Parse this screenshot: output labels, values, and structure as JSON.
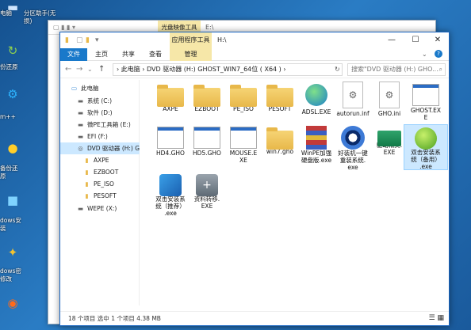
{
  "desktop": {
    "icons": [
      {
        "label": "电脑",
        "icon": "computer-icon"
      },
      {
        "label": "份还原",
        "icon": "backup-icon"
      },
      {
        "label": "m++",
        "icon": "gear-icon"
      },
      {
        "label": "备份还\n原",
        "icon": "ghost-icon"
      },
      {
        "label": "dows安\n装",
        "icon": "windows-installer-icon"
      },
      {
        "label": "dows密\n修改",
        "icon": "key-icon"
      },
      {
        "label": "",
        "icon": "app-icon"
      }
    ],
    "top_label": "分区助手(无\n损)"
  },
  "backwin": {
    "tab": "光盘映像工具",
    "path": "E:\\"
  },
  "window": {
    "context_tab": "应用程序工具",
    "title": "H:\\",
    "ribbon_tabs": [
      "文件",
      "主页",
      "共享",
      "查看",
      "管理"
    ],
    "address": "›  此电脑  ›  DVD 驱动器 (H:) GHOST_WIN7_64位 ( X64 )  ›",
    "search_placeholder": "搜索\"DVD 驱动器 (H:) GHO...",
    "nav": [
      {
        "label": "此电脑",
        "icon": "computer-icon",
        "selected": false
      },
      {
        "label": "系统 (C:)",
        "icon": "drive-icon",
        "selected": false
      },
      {
        "label": "软件 (D:)",
        "icon": "drive-icon",
        "selected": false
      },
      {
        "label": "微PE工具箱 (E:)",
        "icon": "drive-icon",
        "selected": false
      },
      {
        "label": "EFI (F:)",
        "icon": "drive-icon",
        "selected": false
      },
      {
        "label": "DVD 驱动器 (H:) G",
        "icon": "dvd-icon",
        "selected": true
      },
      {
        "label": "AXPE",
        "icon": "folder-icon",
        "selected": false
      },
      {
        "label": "EZBOOT",
        "icon": "folder-icon",
        "selected": false
      },
      {
        "label": "PE_ISO",
        "icon": "folder-icon",
        "selected": false
      },
      {
        "label": "PESOFT",
        "icon": "folder-icon",
        "selected": false
      },
      {
        "label": "WEPE (X:)",
        "icon": "drive-icon",
        "selected": false
      }
    ],
    "files": [
      {
        "label": "AXPE",
        "kind": "folder"
      },
      {
        "label": "EZBOOT",
        "kind": "folder"
      },
      {
        "label": "PE_ISO",
        "kind": "folder"
      },
      {
        "label": "PESOFT",
        "kind": "folder"
      },
      {
        "label": "ADSL.EXE",
        "kind": "globe"
      },
      {
        "label": "autorun.inf",
        "kind": "gear"
      },
      {
        "label": "GHO.ini",
        "kind": "gear"
      },
      {
        "label": "GHOST.EX\nE",
        "kind": "win"
      },
      {
        "label": "HD4.GHO",
        "kind": "win"
      },
      {
        "label": "HD5.GHO",
        "kind": "win"
      },
      {
        "label": "MOUSE.E\nXE",
        "kind": "win"
      },
      {
        "label": "win7.gho",
        "kind": "folder"
      },
      {
        "label": "WinPE加强\n硬盘版.exe",
        "kind": "archive"
      },
      {
        "label": "好装机一键\n重装系统.\nexe",
        "kind": "eye"
      },
      {
        "label": "驱动精灵.\nEXE",
        "kind": "chip"
      },
      {
        "label": "双击安装系\n统（备用）\n.exe",
        "kind": "leaf",
        "selected": true
      },
      {
        "label": "双击安装系\n统（推荐）\n.exe",
        "kind": "disc"
      },
      {
        "label": "资料转移.\nEXE",
        "kind": "user"
      }
    ],
    "status": "18 个项目    选中 1 个项目  4.38 MB"
  }
}
